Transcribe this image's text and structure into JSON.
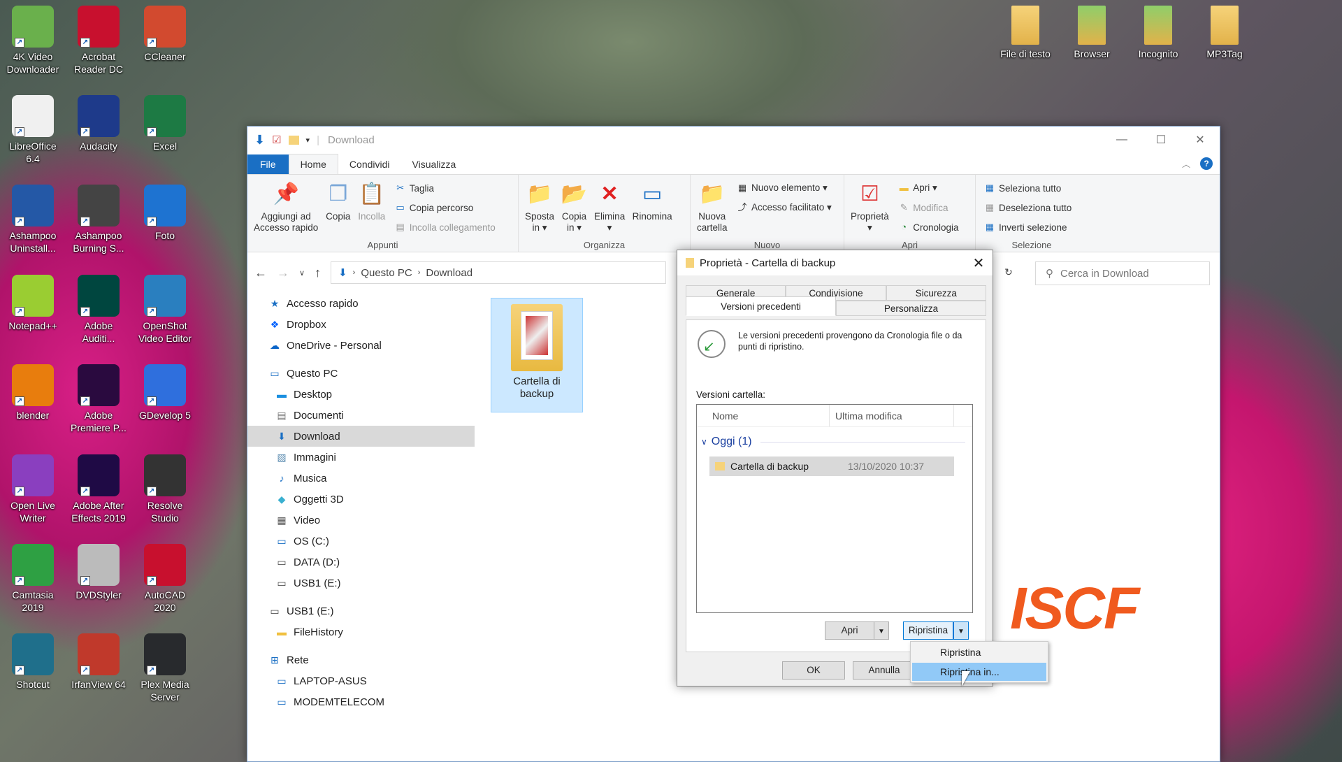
{
  "desktop_icons": [
    {
      "label": "4K Video\nDownloader",
      "icon": "download-circle-icon",
      "color": "#6ab04c"
    },
    {
      "label": "Acrobat\nReader DC",
      "icon": "acrobat-icon",
      "color": "#c8102e"
    },
    {
      "label": "CCleaner",
      "icon": "broom-icon",
      "color": "#d24a2f"
    },
    {
      "label": "LibreOffice\n6.4",
      "icon": "document-icon",
      "color": "#f0f0f0"
    },
    {
      "label": "Audacity",
      "icon": "headphones-icon",
      "color": "#1e3a8a"
    },
    {
      "label": "Excel",
      "icon": "excel-icon",
      "color": "#1d7a44"
    },
    {
      "label": "Ashampoo\nUninstall...",
      "icon": "uninstall-icon",
      "color": "#2458a6"
    },
    {
      "label": "Ashampoo\nBurning S...",
      "icon": "flame-icon",
      "color": "#444444"
    },
    {
      "label": "Foto",
      "icon": "photo-icon",
      "color": "#1e73d1"
    },
    {
      "label": "Notepad++",
      "icon": "notepad-icon",
      "color": "#9acd32"
    },
    {
      "label": "Adobe\nAuditi...",
      "icon": "audition-icon",
      "color": "#00463f"
    },
    {
      "label": "OpenShot\nVideo Editor",
      "icon": "openshot-icon",
      "color": "#2a7fbf"
    },
    {
      "label": "blender",
      "icon": "blender-icon",
      "color": "#e87d0d"
    },
    {
      "label": "Adobe\nPremiere P...",
      "icon": "premiere-icon",
      "color": "#2a0a3f"
    },
    {
      "label": "GDevelop 5",
      "icon": "gdevelop-icon",
      "color": "#2f6fdd"
    },
    {
      "label": "Open Live\nWriter",
      "icon": "cloud-pen-icon",
      "color": "#8a3fbf"
    },
    {
      "label": "Adobe After\nEffects 2019",
      "icon": "after-effects-icon",
      "color": "#1f0a45"
    },
    {
      "label": "Resolve\nStudio",
      "icon": "resolve-icon",
      "color": "#333333"
    },
    {
      "label": "Camtasia\n2019",
      "icon": "camtasia-icon",
      "color": "#2ea043"
    },
    {
      "label": "DVDStyler",
      "icon": "dvd-icon",
      "color": "#bbbbbb"
    },
    {
      "label": "AutoCAD\n2020",
      "icon": "autocad-icon",
      "color": "#c8102e"
    },
    {
      "label": "Shotcut",
      "icon": "shotcut-icon",
      "color": "#1f6f8b"
    },
    {
      "label": "IrfanView 64",
      "icon": "irfanview-icon",
      "color": "#c0392b"
    },
    {
      "label": "Plex Media\nServer",
      "icon": "plex-icon",
      "color": "#282a2d"
    },
    {
      "label": "File di testo",
      "icon": "folder-icon",
      "color": "#f6d37a"
    },
    {
      "label": "Browser",
      "icon": "folder-icon",
      "color": "#8fce6a"
    },
    {
      "label": "Incognito",
      "icon": "folder-icon",
      "color": "#8fce6a"
    },
    {
      "label": "MP3Tag",
      "icon": "folder-icon",
      "color": "#f6d37a"
    }
  ],
  "explorer": {
    "title": "Download",
    "tabs": [
      "File",
      "Home",
      "Condividi",
      "Visualizza"
    ],
    "ribbon": {
      "appunti": {
        "label": "Appunti",
        "pin": "Aggiungi ad\nAccesso rapido",
        "copia": "Copia",
        "incolla": "Incolla",
        "taglia": "Taglia",
        "copia_percorso": "Copia percorso",
        "incolla_collegamento": "Incolla collegamento"
      },
      "organizza": {
        "label": "Organizza",
        "sposta": "Sposta\nin ▾",
        "copia_in": "Copia\nin ▾",
        "elimina": "Elimina\n▾",
        "rinomina": "Rinomina"
      },
      "nuovo": {
        "label": "Nuovo",
        "nuova_cartella": "Nuova\ncartella",
        "nuovo_elemento": "Nuovo elemento ▾",
        "accesso_facilitato": "Accesso facilitato ▾"
      },
      "apri": {
        "label": "Apri",
        "proprieta": "Proprietà\n▾",
        "apri": "Apri ▾",
        "modifica": "Modifica",
        "cronologia": "Cronologia"
      },
      "selezione": {
        "label": "Selezione",
        "seleziona_tutto": "Seleziona tutto",
        "deseleziona_tutto": "Deseleziona tutto",
        "inverti": "Inverti selezione"
      }
    },
    "breadcrumb": [
      "Questo PC",
      "Download"
    ],
    "search_placeholder": "Cerca in Download",
    "nav": [
      {
        "label": "Accesso rapido",
        "icon": "star-icon",
        "indent": 0
      },
      {
        "label": "Dropbox",
        "icon": "dropbox-icon",
        "indent": 0
      },
      {
        "label": "OneDrive - Personal",
        "icon": "onedrive-icon",
        "indent": 0
      },
      {
        "label": "Questo PC",
        "icon": "computer-icon",
        "indent": 0
      },
      {
        "label": "Desktop",
        "icon": "desktop-icon",
        "indent": 1
      },
      {
        "label": "Documenti",
        "icon": "documents-icon",
        "indent": 1
      },
      {
        "label": "Download",
        "icon": "download-icon",
        "indent": 1,
        "selected": true
      },
      {
        "label": "Immagini",
        "icon": "pictures-icon",
        "indent": 1
      },
      {
        "label": "Musica",
        "icon": "music-icon",
        "indent": 1
      },
      {
        "label": "Oggetti 3D",
        "icon": "cube-icon",
        "indent": 1
      },
      {
        "label": "Video",
        "icon": "video-icon",
        "indent": 1
      },
      {
        "label": "OS (C:)",
        "icon": "drive-os-icon",
        "indent": 1
      },
      {
        "label": "DATA (D:)",
        "icon": "drive-icon",
        "indent": 1
      },
      {
        "label": "USB1 (E:)",
        "icon": "usb-drive-icon",
        "indent": 1
      },
      {
        "label": "USB1 (E:)",
        "icon": "usb-drive-icon",
        "indent": 0
      },
      {
        "label": "FileHistory",
        "icon": "folder-icon",
        "indent": 1
      },
      {
        "label": "Rete",
        "icon": "network-icon",
        "indent": 0
      },
      {
        "label": "LAPTOP-ASUS",
        "icon": "computer-icon",
        "indent": 1
      },
      {
        "label": "MODEMTELECOM",
        "icon": "computer-icon",
        "indent": 1
      }
    ],
    "file": {
      "label": "Cartella di\nbackup"
    }
  },
  "dialog": {
    "title": "Proprietà - Cartella di backup",
    "tabs_top": [
      "Generale",
      "Condivisione",
      "Sicurezza"
    ],
    "tabs_bottom": [
      "Versioni precedenti",
      "Personalizza"
    ],
    "info": "Le versioni precedenti provengono da Cronologia file o da punti di ripristino.",
    "versions_label": "Versioni cartella:",
    "col_name": "Nome",
    "col_modified": "Ultima modifica",
    "group": "Oggi (1)",
    "row": {
      "name": "Cartella di backup",
      "date": "13/10/2020 10:37"
    },
    "btn_apri": "Apri",
    "btn_ripristina": "Ripristina",
    "btn_ok": "OK",
    "btn_annulla": "Annulla"
  },
  "menu": [
    "Ripristina",
    "Ripristina in..."
  ],
  "watermark": "ISCF"
}
